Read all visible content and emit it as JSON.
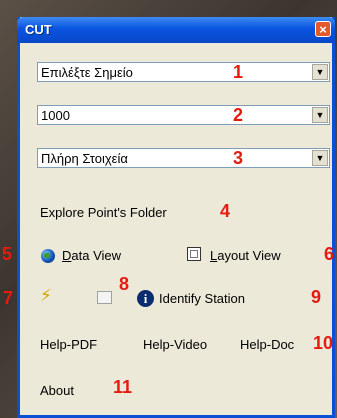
{
  "window": {
    "title": "CUT",
    "close_glyph": "×"
  },
  "combos": {
    "point": {
      "value": "Επιλέξτε Σημείο",
      "arrow": "▼",
      "marker": "1"
    },
    "scale": {
      "value": "1000",
      "arrow": "▼",
      "marker": "2"
    },
    "detail": {
      "value": "Πλήρη Στοιχεία",
      "arrow": "▼",
      "marker": "3"
    }
  },
  "explore": {
    "label": "Explore Point's Folder",
    "marker": "4"
  },
  "views": {
    "data_label_first": "D",
    "data_label_rest": "ata View",
    "layout_label_first": "L",
    "layout_label_rest": "ayout View",
    "marker_left": "5",
    "marker_right": "6"
  },
  "tools": {
    "bolt_glyph": "⚡",
    "tip_marker": "8",
    "identify_label": "Identify Station",
    "marker_left": "7",
    "marker_right": "9"
  },
  "help": {
    "pdf": "Help-PDF",
    "video": "Help-Video",
    "doc": "Help-Doc",
    "marker": "10"
  },
  "about": {
    "label": "About",
    "marker": "11"
  },
  "colors": {
    "annotation": "#e51b12",
    "titlebar": "#0a54e0",
    "panel": "#ece9d8"
  }
}
